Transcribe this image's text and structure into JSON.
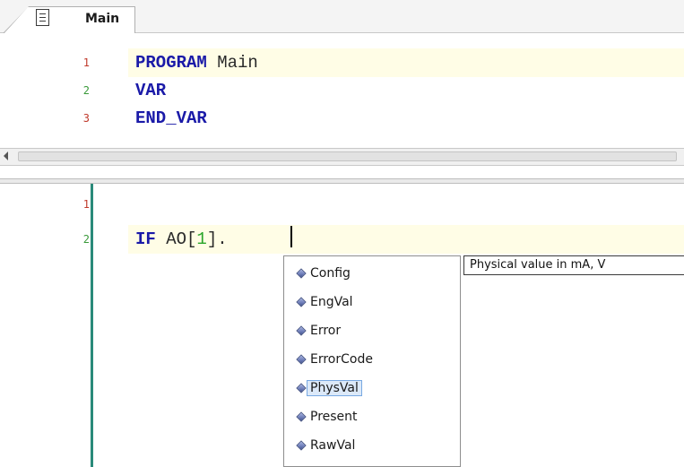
{
  "tab": {
    "label": "Main"
  },
  "declaration": {
    "lines": [
      {
        "number": "1",
        "parts": [
          {
            "text": "PROGRAM",
            "kind": "keyword"
          },
          {
            "text": " Main",
            "kind": "plain"
          }
        ]
      },
      {
        "number": "2",
        "parts": [
          {
            "text": "VAR",
            "kind": "keyword"
          }
        ]
      },
      {
        "number": "3",
        "parts": [
          {
            "text": "END_VAR",
            "kind": "keyword"
          }
        ]
      }
    ]
  },
  "body": {
    "lines": [
      {
        "number": "1",
        "parts": []
      },
      {
        "number": "2",
        "parts": [
          {
            "text": "IF",
            "kind": "keyword"
          },
          {
            "text": " AO[",
            "kind": "plain"
          },
          {
            "text": "1",
            "kind": "number"
          },
          {
            "text": "].",
            "kind": "plain"
          }
        ]
      }
    ]
  },
  "autocomplete": {
    "items": [
      {
        "label": "Config",
        "icon": "member-diamond-icon"
      },
      {
        "label": "EngVal",
        "icon": "member-diamond-icon"
      },
      {
        "label": "Error",
        "icon": "member-diamond-icon"
      },
      {
        "label": "ErrorCode",
        "icon": "member-diamond-icon"
      },
      {
        "label": "PhysVal",
        "icon": "member-diamond-icon",
        "selected": true
      },
      {
        "label": "Present",
        "icon": "member-diamond-icon"
      },
      {
        "label": "RawVal",
        "icon": "member-diamond-icon"
      }
    ]
  },
  "tooltip": {
    "text": "Physical value in mA, V"
  },
  "colors": {
    "keyword": "#1a1aa8",
    "number": "#2aa52a",
    "line_number_odd": "#c0392b",
    "line_number_even": "#3a9a3a",
    "current_line": "#fffde6",
    "change_bar": "#2a8a7a",
    "selection_fill": "#dce9f9",
    "selection_border": "#78a9e2"
  }
}
